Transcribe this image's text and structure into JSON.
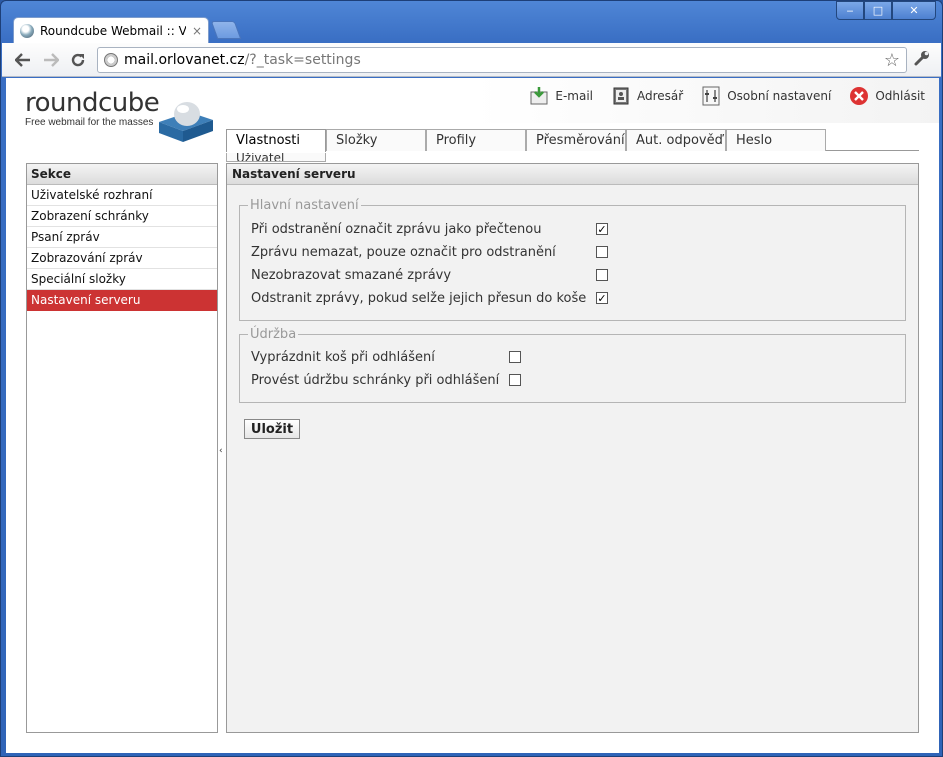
{
  "browser": {
    "tab_title": "Roundcube Webmail :: Vlastno",
    "tab_close": "×",
    "url_host": "mail.orlovanet.cz",
    "url_path": "/?_task=settings",
    "win_min": "‒",
    "win_max": "□",
    "win_close": "✕"
  },
  "logo": {
    "word": "roundcube",
    "tagline": "Free webmail for the masses"
  },
  "topnav": [
    {
      "label": "E-mail",
      "icon": "mail-download-icon"
    },
    {
      "label": "Adresář",
      "icon": "address-book-icon"
    },
    {
      "label": "Osobní nastavení",
      "icon": "personal-settings-icon"
    },
    {
      "label": "Odhlásit",
      "icon": "logout-icon"
    }
  ],
  "tabs": [
    {
      "label": "Vlastnosti",
      "active": true
    },
    {
      "label": "Složky"
    },
    {
      "label": "Profily"
    },
    {
      "label": "Přesměrování"
    },
    {
      "label": "Aut. odpověď"
    },
    {
      "label": "Heslo"
    }
  ],
  "tab_overflow": "Uživatel",
  "sections": {
    "header": "Sekce",
    "items": [
      {
        "label": "Uživatelské rozhraní"
      },
      {
        "label": "Zobrazení schránky"
      },
      {
        "label": "Psaní zpráv"
      },
      {
        "label": "Zobrazování zpráv"
      },
      {
        "label": "Speciální složky"
      },
      {
        "label": "Nastavení serveru",
        "selected": true
      }
    ]
  },
  "panel": {
    "header": "Nastavení serveru",
    "main_legend": "Hlavní nastavení",
    "main_options": [
      {
        "label": "Při odstranění označit zprávu jako přečtenou",
        "checked": true
      },
      {
        "label": "Zprávu nemazat, pouze označit pro odstranění",
        "checked": false
      },
      {
        "label": "Nezobrazovat smazané zprávy",
        "checked": false
      },
      {
        "label": "Odstranit zprávy, pokud selže jejich přesun do koše",
        "checked": true
      }
    ],
    "maint_legend": "Údržba",
    "maint_options": [
      {
        "label": "Vyprázdnit koš při odhlášení",
        "checked": false
      },
      {
        "label": "Provést údržbu schránky při odhlášení",
        "checked": false
      }
    ],
    "save_label": "Uložit"
  },
  "colors": {
    "selected_section": "#cc3333",
    "chrome_blue": "#3a6fc4"
  }
}
